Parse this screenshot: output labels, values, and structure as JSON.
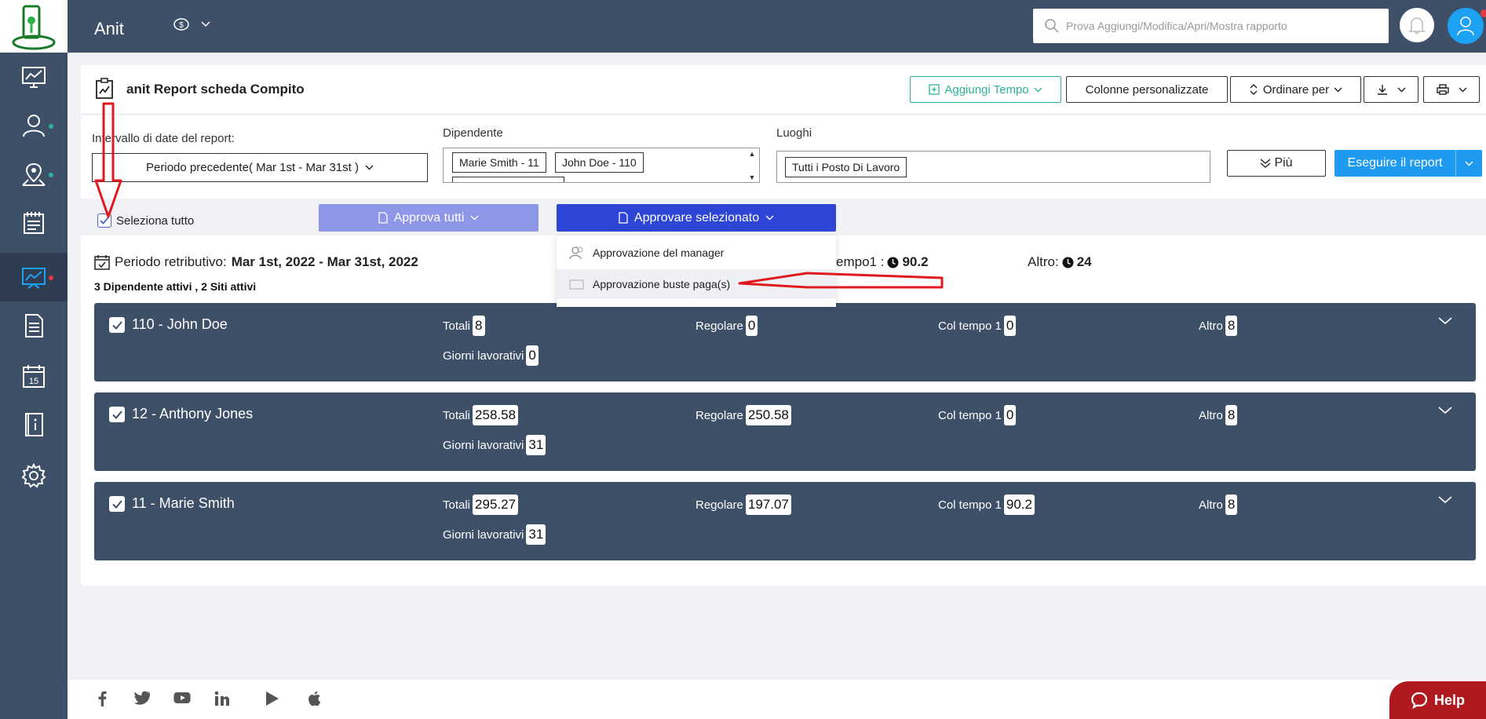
{
  "app": {
    "title": "Anit"
  },
  "search": {
    "placeholder": "Prova Aggiungi/Modifica/Apri/Mostra rapporto"
  },
  "colors": {
    "sidebar": "#3e5068",
    "accent_blue": "#1e9bf0",
    "approve_selected": "#2e45d6",
    "approve_all": "#8e96e8",
    "green": "#2bb39a",
    "help": "#b0191d"
  },
  "sidebar": {
    "items": [
      {
        "icon": "dashboard-icon"
      },
      {
        "icon": "users-icon"
      },
      {
        "icon": "location-icon"
      },
      {
        "icon": "timesheet-icon"
      },
      {
        "icon": "reports-icon"
      },
      {
        "icon": "document-icon"
      },
      {
        "icon": "calendar-icon",
        "label": "15"
      },
      {
        "icon": "info-book-icon"
      },
      {
        "icon": "settings-icon"
      }
    ]
  },
  "report": {
    "title": "anit Report scheda Compito",
    "toolbar": {
      "add_time": "Aggiungi Tempo",
      "custom_columns": "Colonne personalizzate",
      "sort_by": "Ordinare per"
    },
    "filters": {
      "date_range_label": "Intervallo di date del report:",
      "date_range_value": "Periodo precedente( Mar 1st - Mar 31st )",
      "employee_label": "Dipendente",
      "employees": [
        "Marie Smith - 11",
        "John Doe - 110"
      ],
      "locations_label": "Luoghi",
      "location_value": "Tutti i Posto Di Lavoro",
      "more": "Più",
      "run": "Eseguire il report"
    },
    "select_all": "Seleziona tutto",
    "approve_all": "Approva tutti",
    "approve_selected": "Approvare selezionato",
    "dropdown": [
      "Approvazione del manager",
      "Approvazione buste paga(s)"
    ],
    "period_label": "Periodo retributivo:",
    "period_value": "Mar 1st, 2022 - Mar 31st, 2022",
    "active_summary": "3 Dipendente attivi , 2 Siti attivi",
    "overtime_label": "empo1 :",
    "overtime_value": "90.2",
    "other_label": "Altro:",
    "other_value": "24"
  },
  "labels": {
    "total": "Totali",
    "regular": "Regolare",
    "overtime": "Col tempo 1",
    "other": "Altro",
    "workdays": "Giorni lavorativi"
  },
  "employees": [
    {
      "name": "110 - John Doe",
      "total": "8",
      "regular": "0",
      "overtime": "0",
      "other": "8",
      "workdays": "0"
    },
    {
      "name": "12 - Anthony Jones",
      "total": "258.58",
      "regular": "250.58",
      "overtime": "0",
      "other": "8",
      "workdays": "31"
    },
    {
      "name": "11 - Marie Smith",
      "total": "295.27",
      "regular": "197.07",
      "overtime": "90.2",
      "other": "8",
      "workdays": "31"
    }
  ],
  "help": {
    "label": "Help"
  }
}
